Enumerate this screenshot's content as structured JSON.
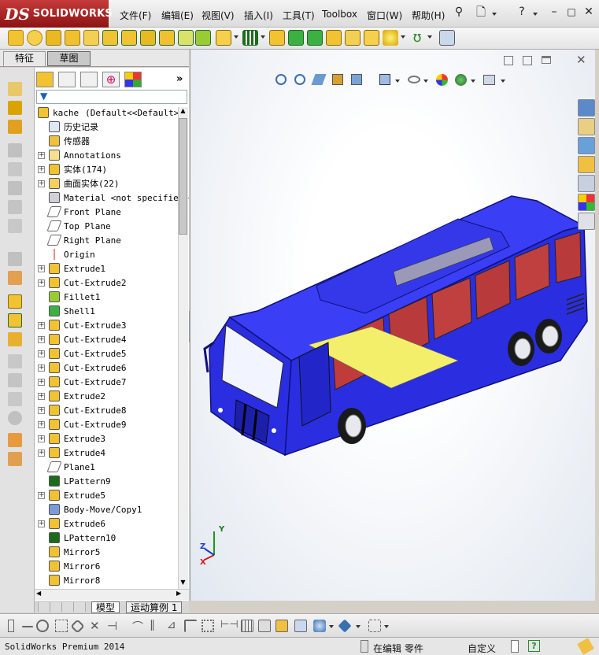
{
  "app": {
    "logo_ds": "DS",
    "logo_brand": "SOLIDWORKS"
  },
  "menu": [
    {
      "label": "文件(F)"
    },
    {
      "label": "编辑(E)"
    },
    {
      "label": "视图(V)"
    },
    {
      "label": "插入(I)"
    },
    {
      "label": "工具(T)"
    },
    {
      "label": "Toolbox"
    },
    {
      "label": "窗口(W)"
    },
    {
      "label": "帮助(H)"
    }
  ],
  "feature_tabs": [
    {
      "label": "特征"
    },
    {
      "label": "草图"
    }
  ],
  "tree": {
    "root_part": "kache",
    "root_config": "(Default<<Default>_\"",
    "items": [
      {
        "label": "历史记录",
        "icon": "history-icon",
        "expand": false
      },
      {
        "label": "传感器",
        "icon": "sensor-icon",
        "expand": false
      },
      {
        "label": "Annotations",
        "icon": "annotations-icon",
        "expand": true
      },
      {
        "label": "实体(174)",
        "icon": "solid-bodies-icon",
        "expand": true
      },
      {
        "label": "曲面实体(22)",
        "icon": "surface-bodies-icon",
        "expand": true
      },
      {
        "label": "Material <not specified>",
        "icon": "material-icon",
        "expand": false
      },
      {
        "label": "Front Plane",
        "icon": "plane-icon",
        "expand": false
      },
      {
        "label": "Top Plane",
        "icon": "plane-icon",
        "expand": false
      },
      {
        "label": "Right Plane",
        "icon": "plane-icon",
        "expand": false
      },
      {
        "label": "Origin",
        "icon": "origin-icon",
        "expand": false
      },
      {
        "label": "Extrude1",
        "icon": "extrude-icon",
        "expand": true
      },
      {
        "label": "Cut-Extrude2",
        "icon": "cut-extrude-icon",
        "expand": true
      },
      {
        "label": "Fillet1",
        "icon": "fillet-icon",
        "expand": false
      },
      {
        "label": "Shell1",
        "icon": "shell-icon",
        "expand": false
      },
      {
        "label": "Cut-Extrude3",
        "icon": "cut-extrude-icon",
        "expand": true
      },
      {
        "label": "Cut-Extrude4",
        "icon": "cut-extrude-icon",
        "expand": true
      },
      {
        "label": "Cut-Extrude5",
        "icon": "cut-extrude-icon",
        "expand": true
      },
      {
        "label": "Cut-Extrude6",
        "icon": "cut-extrude-icon",
        "expand": true
      },
      {
        "label": "Cut-Extrude7",
        "icon": "cut-extrude-icon",
        "expand": true
      },
      {
        "label": "Extrude2",
        "icon": "extrude-icon",
        "expand": true
      },
      {
        "label": "Cut-Extrude8",
        "icon": "cut-extrude-icon",
        "expand": true
      },
      {
        "label": "Cut-Extrude9",
        "icon": "cut-extrude-icon",
        "expand": true
      },
      {
        "label": "Extrude3",
        "icon": "extrude-icon",
        "expand": true
      },
      {
        "label": "Extrude4",
        "icon": "extrude-icon",
        "expand": true
      },
      {
        "label": "Plane1",
        "icon": "plane-icon",
        "expand": false
      },
      {
        "label": "LPattern9",
        "icon": "linear-pattern-icon",
        "expand": false
      },
      {
        "label": "Extrude5",
        "icon": "extrude-icon",
        "expand": true
      },
      {
        "label": "Body-Move/Copy1",
        "icon": "move-copy-icon",
        "expand": false
      },
      {
        "label": "Extrude6",
        "icon": "extrude-icon",
        "expand": true
      },
      {
        "label": "LPattern10",
        "icon": "linear-pattern-icon",
        "expand": false
      },
      {
        "label": "Mirror5",
        "icon": "mirror-icon",
        "expand": false
      },
      {
        "label": "Mirror6",
        "icon": "mirror-icon",
        "expand": false
      },
      {
        "label": "Mirror8",
        "icon": "mirror-icon",
        "expand": false
      }
    ]
  },
  "model_tabs": [
    {
      "label": "模型"
    },
    {
      "label": "运动算例 1"
    }
  ],
  "triad": {
    "x": "X",
    "y": "Y",
    "z": "Z"
  },
  "status": {
    "product": "SolidWorks Premium 2014",
    "editing": "在编辑 零件",
    "units": "自定义"
  },
  "colors": {
    "bus_body": "#2a2ee0",
    "bus_roof": "#3a3ef5",
    "seats": "#b83a3a",
    "floor": "#f4ef6a",
    "titlebar_logo": "#a01818"
  }
}
